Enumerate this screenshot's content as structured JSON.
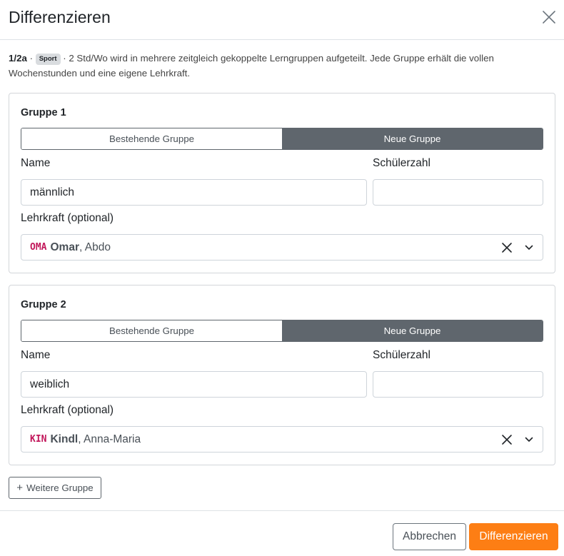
{
  "dialog": {
    "title": "Differenzieren",
    "close_icon": "close-icon"
  },
  "info": {
    "class": "1/2a",
    "sep1": " · ",
    "subject_badge": "Sport",
    "text_line1": " · 2 Std/Wo wird in mehrere zeitgleich gekoppelte Lerngruppen aufgeteilt. Jede Gruppe erhält die vollen",
    "text_line2": "Wochenstunden und eine eigene Lehrkraft."
  },
  "labels": {
    "name": "Name",
    "student_count": "Schülerzahl",
    "teacher": "Lehrkraft (optional)"
  },
  "groups": [
    {
      "title": "Gruppe 1",
      "mode_existing": "Bestehende Gruppe",
      "mode_new": "Neue Gruppe",
      "selected_mode": "Neue Gruppe",
      "name_value": "männlich",
      "student_count_value": "",
      "teacher": {
        "abbr": "OMA",
        "last_name": "Omar",
        "first_name": ", Abdo"
      }
    },
    {
      "title": "Gruppe 2",
      "mode_existing": "Bestehende Gruppe",
      "mode_new": "Neue Gruppe",
      "selected_mode": "Neue Gruppe",
      "name_value": "weiblich",
      "student_count_value": "",
      "teacher": {
        "abbr": "KIN",
        "last_name": "Kindl",
        "first_name": ", Anna-Maria"
      }
    }
  ],
  "actions": {
    "add_group": "Weitere Gruppe",
    "add_group_icon": "plus-icon",
    "cancel": "Abbrechen",
    "submit": "Differenzieren"
  },
  "colors": {
    "primary": "#fd7e14",
    "segment_active": "#5f666d",
    "teacher_abbr": "#c2185b"
  }
}
